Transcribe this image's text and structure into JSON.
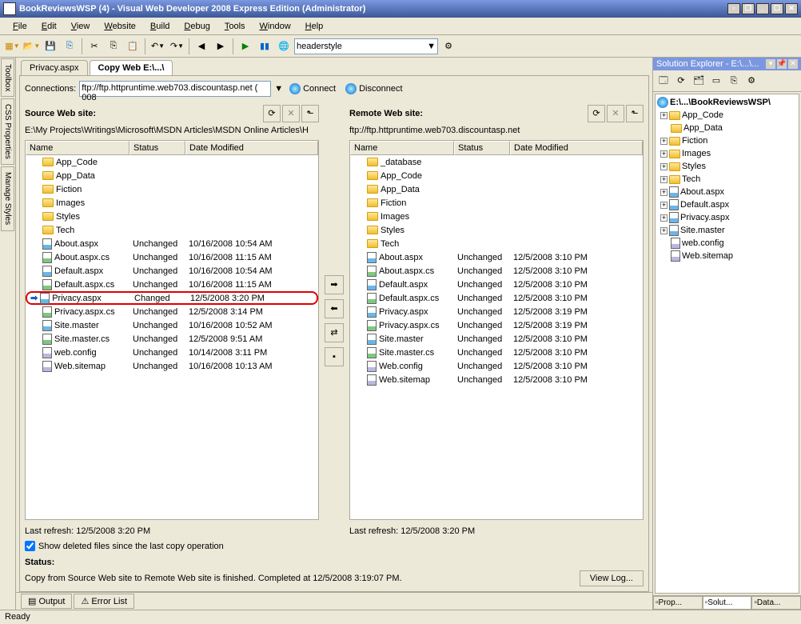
{
  "title": "BookReviewsWSP (4) - Visual Web Developer 2008 Express Edition (Administrator)",
  "menu": [
    "File",
    "Edit",
    "View",
    "Website",
    "Build",
    "Debug",
    "Tools",
    "Window",
    "Help"
  ],
  "combo": "headerstyle",
  "left_dock": [
    "Toolbox",
    "CSS Properties",
    "Manage Styles"
  ],
  "doc_tabs": [
    {
      "label": "Privacy.aspx",
      "active": false
    },
    {
      "label": "Copy Web E:\\...\\",
      "active": true
    }
  ],
  "connections_label": "Connections:",
  "connections_value": "ftp://ftp.httpruntime.web703.discountasp.net ( 008",
  "connect_label": "Connect",
  "disconnect_label": "Disconnect",
  "source": {
    "title": "Source Web site:",
    "path": "E:\\My Projects\\Writings\\Microsoft\\MSDN Articles\\MSDN Online Articles\\H",
    "cols": [
      "Name",
      "Status",
      "Date Modified"
    ],
    "rows": [
      {
        "t": "folder",
        "n": "App_Code",
        "s": "",
        "d": ""
      },
      {
        "t": "folder",
        "n": "App_Data",
        "s": "",
        "d": ""
      },
      {
        "t": "folder",
        "n": "Fiction",
        "s": "",
        "d": ""
      },
      {
        "t": "folder",
        "n": "Images",
        "s": "",
        "d": ""
      },
      {
        "t": "folder",
        "n": "Styles",
        "s": "",
        "d": ""
      },
      {
        "t": "folder",
        "n": "Tech",
        "s": "",
        "d": ""
      },
      {
        "t": "aspx",
        "n": "About.aspx",
        "s": "Unchanged",
        "d": "10/16/2008 10:54 AM"
      },
      {
        "t": "cs",
        "n": "About.aspx.cs",
        "s": "Unchanged",
        "d": "10/16/2008 11:15 AM"
      },
      {
        "t": "aspx",
        "n": "Default.aspx",
        "s": "Unchanged",
        "d": "10/16/2008 10:54 AM"
      },
      {
        "t": "cs",
        "n": "Default.aspx.cs",
        "s": "Unchanged",
        "d": "10/16/2008 11:15 AM"
      },
      {
        "t": "aspx",
        "n": "Privacy.aspx",
        "s": "Changed",
        "d": "12/5/2008 3:20 PM",
        "hl": true,
        "arr": true
      },
      {
        "t": "cs",
        "n": "Privacy.aspx.cs",
        "s": "Unchanged",
        "d": "12/5/2008 3:14 PM"
      },
      {
        "t": "aspx",
        "n": "Site.master",
        "s": "Unchanged",
        "d": "10/16/2008 10:52 AM"
      },
      {
        "t": "cs",
        "n": "Site.master.cs",
        "s": "Unchanged",
        "d": "12/5/2008 9:51 AM"
      },
      {
        "t": "cfg",
        "n": "web.config",
        "s": "Unchanged",
        "d": "10/14/2008 3:11 PM"
      },
      {
        "t": "cfg",
        "n": "Web.sitemap",
        "s": "Unchanged",
        "d": "10/16/2008 10:13 AM"
      }
    ],
    "refresh": "Last refresh: 12/5/2008 3:20 PM"
  },
  "remote": {
    "title": "Remote Web site:",
    "path": "ftp://ftp.httpruntime.web703.discountasp.net",
    "cols": [
      "Name",
      "Status",
      "Date Modified"
    ],
    "rows": [
      {
        "t": "folder",
        "n": "_database",
        "s": "",
        "d": ""
      },
      {
        "t": "folder",
        "n": "App_Code",
        "s": "",
        "d": ""
      },
      {
        "t": "folder",
        "n": "App_Data",
        "s": "",
        "d": ""
      },
      {
        "t": "folder",
        "n": "Fiction",
        "s": "",
        "d": ""
      },
      {
        "t": "folder",
        "n": "Images",
        "s": "",
        "d": ""
      },
      {
        "t": "folder",
        "n": "Styles",
        "s": "",
        "d": ""
      },
      {
        "t": "folder",
        "n": "Tech",
        "s": "",
        "d": ""
      },
      {
        "t": "aspx",
        "n": "About.aspx",
        "s": "Unchanged",
        "d": "12/5/2008 3:10 PM"
      },
      {
        "t": "cs",
        "n": "About.aspx.cs",
        "s": "Unchanged",
        "d": "12/5/2008 3:10 PM"
      },
      {
        "t": "aspx",
        "n": "Default.aspx",
        "s": "Unchanged",
        "d": "12/5/2008 3:10 PM"
      },
      {
        "t": "cs",
        "n": "Default.aspx.cs",
        "s": "Unchanged",
        "d": "12/5/2008 3:10 PM"
      },
      {
        "t": "aspx",
        "n": "Privacy.aspx",
        "s": "Unchanged",
        "d": "12/5/2008 3:19 PM"
      },
      {
        "t": "cs",
        "n": "Privacy.aspx.cs",
        "s": "Unchanged",
        "d": "12/5/2008 3:19 PM"
      },
      {
        "t": "aspx",
        "n": "Site.master",
        "s": "Unchanged",
        "d": "12/5/2008 3:10 PM"
      },
      {
        "t": "cs",
        "n": "Site.master.cs",
        "s": "Unchanged",
        "d": "12/5/2008 3:10 PM"
      },
      {
        "t": "cfg",
        "n": "Web.config",
        "s": "Unchanged",
        "d": "12/5/2008 3:10 PM"
      },
      {
        "t": "cfg",
        "n": "Web.sitemap",
        "s": "Unchanged",
        "d": "12/5/2008 3:10 PM"
      }
    ],
    "refresh": "Last refresh: 12/5/2008 3:20 PM"
  },
  "show_deleted": "Show deleted files since the last copy operation",
  "status_label": "Status:",
  "status_text": "Copy from Source Web site to Remote Web site is finished. Completed at 12/5/2008 3:19:07 PM.",
  "view_log": "View Log...",
  "bottom_tabs": [
    "Output",
    "Error List"
  ],
  "solution": {
    "title": "Solution Explorer - E:\\...\\...",
    "root": "E:\\...\\BookReviewsWSP\\",
    "nodes": [
      {
        "t": "folder",
        "n": "App_Code",
        "exp": "+",
        "lvl": 1
      },
      {
        "t": "folder",
        "n": "App_Data",
        "exp": "",
        "lvl": 1
      },
      {
        "t": "folder",
        "n": "Fiction",
        "exp": "+",
        "lvl": 1
      },
      {
        "t": "folder",
        "n": "Images",
        "exp": "+",
        "lvl": 1
      },
      {
        "t": "folder",
        "n": "Styles",
        "exp": "+",
        "lvl": 1
      },
      {
        "t": "folder",
        "n": "Tech",
        "exp": "+",
        "lvl": 1
      },
      {
        "t": "aspx",
        "n": "About.aspx",
        "exp": "+",
        "lvl": 1
      },
      {
        "t": "aspx",
        "n": "Default.aspx",
        "exp": "+",
        "lvl": 1
      },
      {
        "t": "aspx",
        "n": "Privacy.aspx",
        "exp": "+",
        "lvl": 1
      },
      {
        "t": "aspx",
        "n": "Site.master",
        "exp": "+",
        "lvl": 1
      },
      {
        "t": "cfg",
        "n": "web.config",
        "exp": "",
        "lvl": 1
      },
      {
        "t": "cfg",
        "n": "Web.sitemap",
        "exp": "",
        "lvl": 1
      }
    ],
    "btabs": [
      "Prop...",
      "Solut...",
      "Data..."
    ]
  },
  "statusbar": "Ready"
}
